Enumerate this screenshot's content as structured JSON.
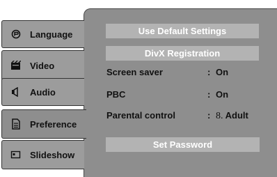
{
  "tabs": [
    {
      "label": "Language",
      "icon": "language-icon"
    },
    {
      "label": "Video",
      "icon": "video-icon"
    },
    {
      "label": "Audio",
      "icon": "audio-icon"
    },
    {
      "label": "Preference",
      "icon": "preference-icon",
      "selected": true
    },
    {
      "label": "Slideshow",
      "icon": "slideshow-icon"
    }
  ],
  "menu": {
    "use_default_label": "Use Default Settings",
    "divx_label": "DivX Registration",
    "settings": [
      {
        "label": "Screen saver",
        "separator": ":",
        "value": "On"
      },
      {
        "label": "PBC",
        "separator": ":",
        "value": "On"
      },
      {
        "label": "Parental control",
        "separator": ":",
        "value_number": "8.",
        "value_text": "Adult"
      }
    ],
    "set_password_label": "Set Password"
  },
  "colors": {
    "panel": "#8e8e8e",
    "tab": "#9c9c9c",
    "menu_bar": "#b3b3b3",
    "bar_text": "#ffffff"
  }
}
